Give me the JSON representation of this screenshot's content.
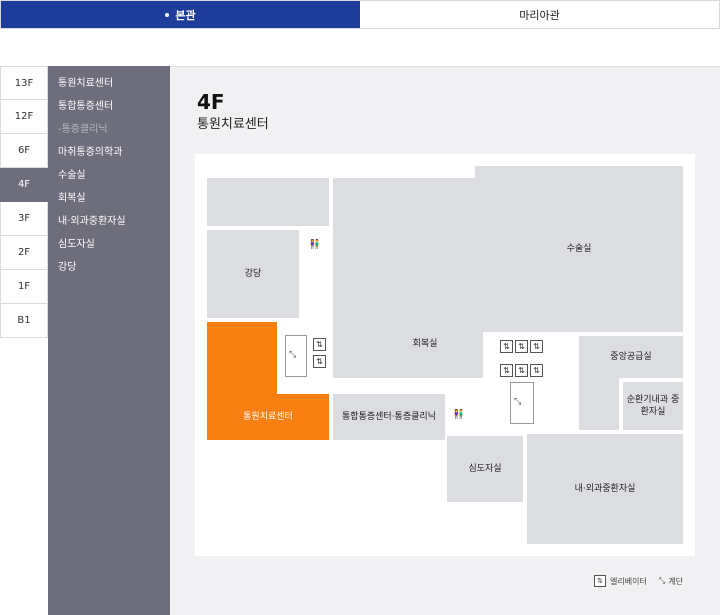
{
  "buildings": {
    "tabs": [
      {
        "label": "본관"
      },
      {
        "label": "마리아관"
      }
    ]
  },
  "floors": [
    "13F",
    "12F",
    "6F",
    "4F",
    "3F",
    "2F",
    "1F",
    "B1"
  ],
  "departments": [
    {
      "label": "통원치료센터"
    },
    {
      "label": "통합통증센터"
    },
    {
      "label": "-통증클리닉"
    },
    {
      "label": "마취통증의학과"
    },
    {
      "label": "수술실"
    },
    {
      "label": "회복실"
    },
    {
      "label": "내·외과중환자실"
    },
    {
      "label": "심도자실"
    },
    {
      "label": "강당"
    }
  ],
  "main": {
    "floor": "4F",
    "subtitle": "통원치료센터"
  },
  "map": {
    "rooms": {
      "hall": "강당",
      "surgery": "수술실",
      "recovery": "회복실",
      "outpatient": "통원치료센터",
      "pain": "통합통증센터·통증클리닉",
      "central_supply": "중앙공급실",
      "circ_icu": "순환기내과 중환자실",
      "cath": "심도자실",
      "icu": "내·외과중환자실"
    },
    "highlight_color": "#f87f12"
  },
  "legend": {
    "elevator": "엘리베이터",
    "stairs": "계단"
  },
  "colors": {
    "active_tab": "#1e3d9a",
    "sidebar": "#6d6d7b",
    "room": "#dcdde0"
  }
}
